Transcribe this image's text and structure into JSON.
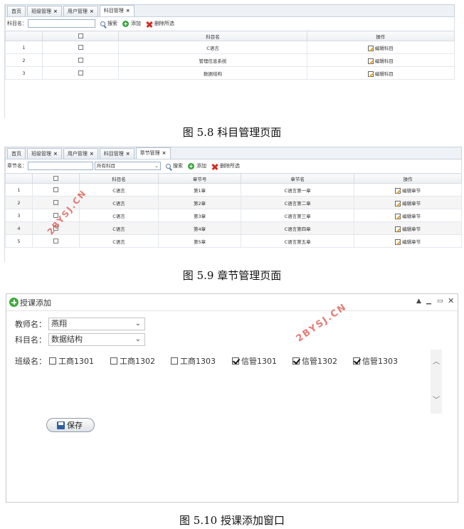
{
  "fig1": {
    "tabs": [
      {
        "label": "首页",
        "close": false
      },
      {
        "label": "班级管理",
        "close": true
      },
      {
        "label": "用户管理",
        "close": true
      },
      {
        "label": "科目管理",
        "close": true,
        "active": true
      }
    ],
    "toolbar": {
      "filter_label": "科目名：",
      "search": "搜索",
      "add": "添加",
      "delete_selected": "删除所选"
    },
    "columns": [
      "",
      "",
      "科目名",
      "操作"
    ],
    "rows": [
      {
        "no": "1",
        "name": "C语言",
        "action": "编辑科目"
      },
      {
        "no": "2",
        "name": "管理信息系统",
        "action": "编辑科目"
      },
      {
        "no": "3",
        "name": "数据结构",
        "action": "编辑科目"
      }
    ],
    "caption": "图 5.8  科目管理页面"
  },
  "fig2": {
    "tabs": [
      {
        "label": "首页",
        "close": false
      },
      {
        "label": "班级管理",
        "close": true
      },
      {
        "label": "用户管理",
        "close": true
      },
      {
        "label": "科目管理",
        "close": true
      },
      {
        "label": "章节管理",
        "close": true,
        "active": true
      }
    ],
    "toolbar": {
      "filter_label": "章节名：",
      "course_select": "所有科目",
      "search": "搜索",
      "add": "添加",
      "delete_selected": "删除所选"
    },
    "columns": [
      "",
      "",
      "科目名",
      "章节号",
      "章节名",
      "操作"
    ],
    "rows": [
      {
        "no": "1",
        "course": "C语言",
        "chapter_no": "第1章",
        "chapter": "C语言第一章",
        "action": "编辑章节"
      },
      {
        "no": "2",
        "course": "C语言",
        "chapter_no": "第2章",
        "chapter": "C语言第二章",
        "action": "编辑章节"
      },
      {
        "no": "3",
        "course": "C语言",
        "chapter_no": "第3章",
        "chapter": "C语言第三章",
        "action": "编辑章节"
      },
      {
        "no": "4",
        "course": "C语言",
        "chapter_no": "第4章",
        "chapter": "C语言第四章",
        "action": "编辑章节"
      },
      {
        "no": "5",
        "course": "C语言",
        "chapter_no": "第5章",
        "chapter": "C语言第五章",
        "action": "编辑章节"
      }
    ],
    "caption": "图 5.9  章节管理页面"
  },
  "fig3": {
    "window_title": "授课添加",
    "teacher_label": "教师名：",
    "teacher_value": "燕翔",
    "course_label": "科目名：",
    "course_value": "数据结构",
    "class_label": "班级名：",
    "classes": [
      {
        "label": "工商1301",
        "checked": false
      },
      {
        "label": "工商1302",
        "checked": false
      },
      {
        "label": "工商1303",
        "checked": false
      },
      {
        "label": "信管1301",
        "checked": true
      },
      {
        "label": "信管1302",
        "checked": true
      },
      {
        "label": "信管1303",
        "checked": true
      }
    ],
    "save_label": "保存",
    "caption": "图 5.10  授课添加窗口"
  },
  "watermark": "2BYSJ.CN",
  "colors": {
    "accent_green": "#37a33a",
    "delete_red": "#d12b1f",
    "header_bg": "#eef2f6",
    "watermark": "#d6463c"
  }
}
